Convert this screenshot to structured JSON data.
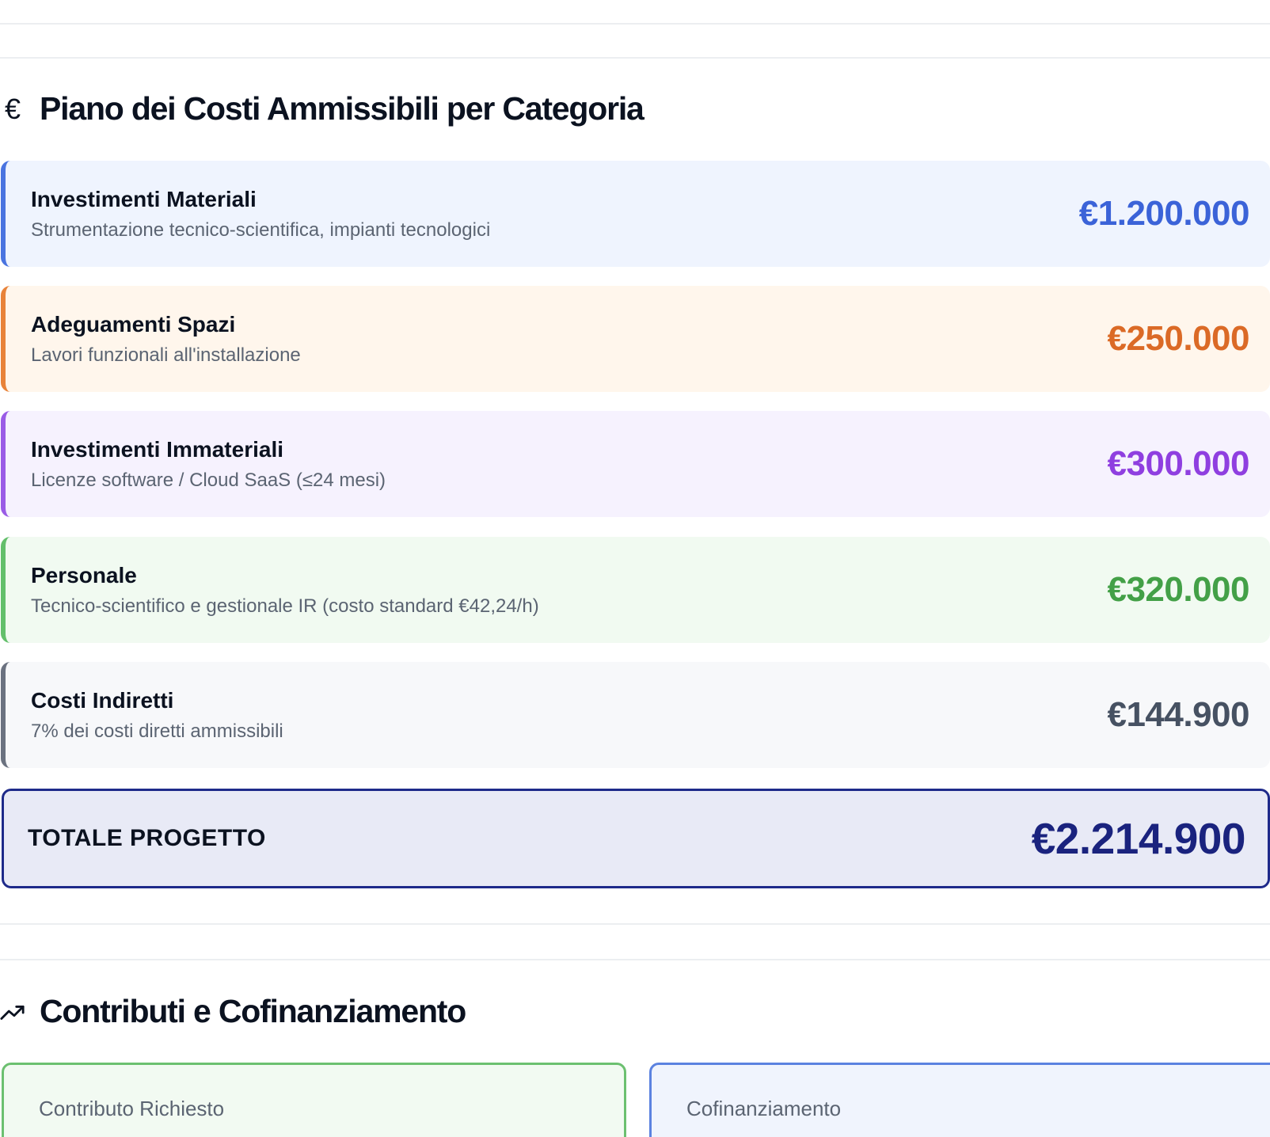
{
  "costs_section": {
    "icon": "euro-icon",
    "icon_glyph": "€",
    "title": "Piano dei Costi Ammissibili per Categoria",
    "items": [
      {
        "name": "Investimenti Materiali",
        "description": "Strumentazione tecnico-scientifica, impianti tecnologici",
        "amount": "€1.200.000",
        "accent": "#4a74e0",
        "background": "#eff4fe",
        "amount_color": "#3b63d8"
      },
      {
        "name": "Adeguamenti Spazi",
        "description": "Lavori funzionali all'installazione",
        "amount": "€250.000",
        "accent": "#e8833a",
        "background": "#fff6ec",
        "amount_color": "#db6a26"
      },
      {
        "name": "Investimenti Immateriali",
        "description": "Licenze software / Cloud SaaS (≤24 mesi)",
        "amount": "€300.000",
        "accent": "#9a5ce6",
        "background": "#f6f2fe",
        "amount_color": "#8f3fe0"
      },
      {
        "name": "Personale",
        "description": "Tecnico-scientifico e gestionale IR (costo standard €42,24/h)",
        "amount": "€320.000",
        "accent": "#63bf6b",
        "background": "#f1faf1",
        "amount_color": "#43a047"
      },
      {
        "name": "Costi Indiretti",
        "description": "7% dei costi diretti ammissibili",
        "amount": "€144.900",
        "accent": "#6b7280",
        "background": "#f7f8fa",
        "amount_color": "#465162"
      }
    ],
    "total": {
      "label": "TOTALE PROGETTO",
      "amount": "€2.214.900"
    }
  },
  "contributions_section": {
    "icon": "trending-up-icon",
    "title": "Contributi e Cofinanziamento",
    "cards": [
      {
        "label": "Contributo Richiesto",
        "border": "#6cc070",
        "background": "#f2faf2"
      },
      {
        "label": "Cofinanziamento",
        "border": "#5b82e0",
        "background": "#f0f4fd"
      }
    ]
  }
}
